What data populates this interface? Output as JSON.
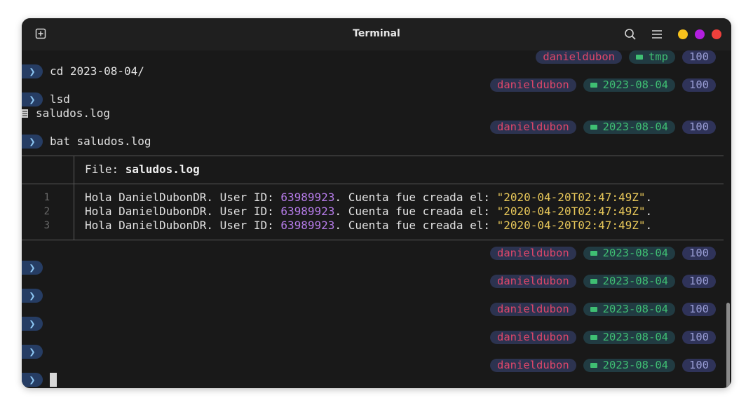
{
  "window": {
    "title": "Terminal"
  },
  "colors": {
    "close": "#f0403c",
    "minimize": "#f7c21c",
    "maximize": "#b31fdf",
    "user": "#e0476a",
    "dir": "#3fbf73",
    "exit_code": "#9a9ed6",
    "number": "#b57be8",
    "string": "#e8c85a"
  },
  "icons": {
    "new_tab": "plus-square-icon",
    "search": "search-icon",
    "menu": "hamburger-menu-icon",
    "prompt": "chevron-right-icon",
    "folder": "folder-icon",
    "file": "file-icon"
  },
  "prompt_symbol": "❯",
  "rprompts": [
    {
      "user": "danieldubon",
      "dir": "tmp",
      "code": "100"
    },
    {
      "user": "danieldubon",
      "dir": "2023-08-04",
      "code": "100"
    },
    {
      "user": "danieldubon",
      "dir": "2023-08-04",
      "code": "100"
    },
    {
      "user": "danieldubon",
      "dir": "2023-08-04",
      "code": "100"
    },
    {
      "user": "danieldubon",
      "dir": "2023-08-04",
      "code": "100"
    },
    {
      "user": "danieldubon",
      "dir": "2023-08-04",
      "code": "100"
    },
    {
      "user": "danieldubon",
      "dir": "2023-08-04",
      "code": "100"
    },
    {
      "user": "danieldubon",
      "dir": "2023-08-04",
      "code": "100"
    }
  ],
  "commands": [
    "cd 2023-08-04/",
    "lsd",
    "bat saludos.log"
  ],
  "lsd_output": "saludos.log",
  "bat": {
    "file_label": "File: ",
    "file_name": "saludos.log",
    "lines": [
      {
        "no": "1",
        "pre": "Hola DanielDubonDR. User ID: ",
        "num": "63989923",
        "mid": ". Cuenta fue creada el: ",
        "str": "\"2020-04-20T02:47:49Z\"",
        "end": "."
      },
      {
        "no": "2",
        "pre": "Hola DanielDubonDR. User ID: ",
        "num": "63989923",
        "mid": ". Cuenta fue creada el: ",
        "str": "\"2020-04-20T02:47:49Z\"",
        "end": "."
      },
      {
        "no": "3",
        "pre": "Hola DanielDubonDR. User ID: ",
        "num": "63989923",
        "mid": ". Cuenta fue creada el: ",
        "str": "\"2020-04-20T02:47:49Z\"",
        "end": "."
      }
    ]
  }
}
